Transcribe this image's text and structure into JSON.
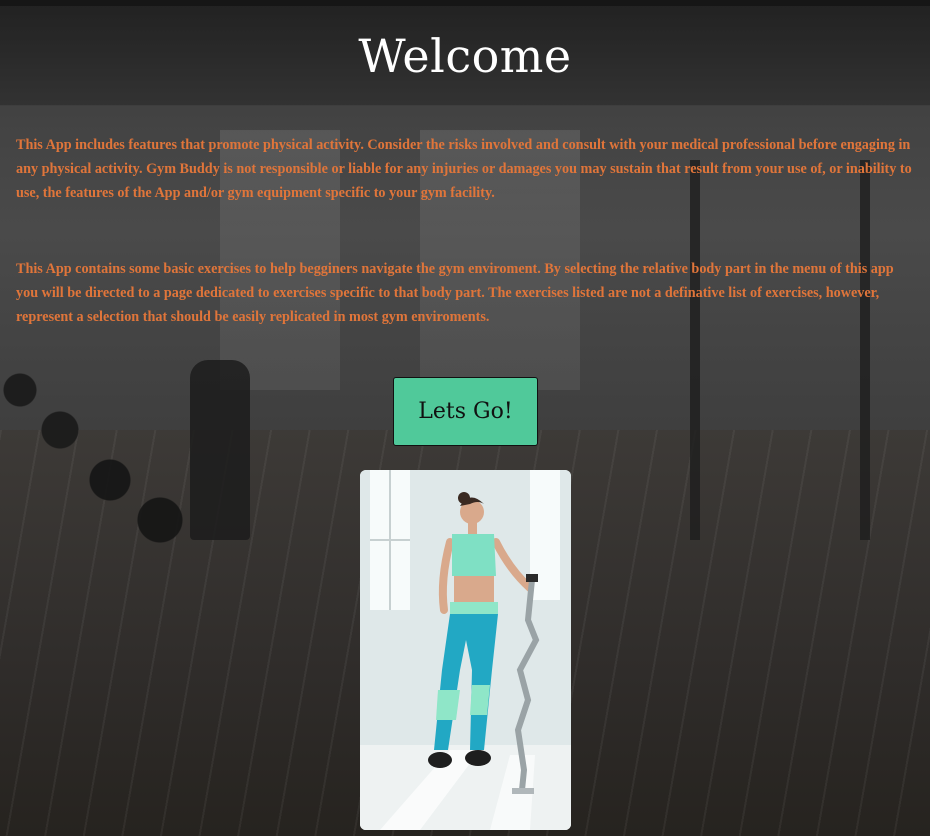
{
  "header": {
    "title": "Welcome"
  },
  "main": {
    "disclaimer": "This App includes features that promote physical activity. Consider the risks involved and consult with your medical professional before engaging in any physical activity. Gym Buddy is not responsible or liable for any injuries or damages you may sustain that result from your use of, or inability to use, the features of the App and/or gym equipment specific to your gym facility.",
    "intro": "This App contains some basic exercises to help begginers navigate the gym enviroment. By selecting the relative body part in the menu of this app you will be directed to a page dedicated to exercises specific to that body part. The exercises listed are not a definative list of exercises, however, represent a selection that should be easily replicated in most gym enviroments.",
    "cta_label": "Lets Go!"
  },
  "colors": {
    "text_accent": "#e0753a",
    "button": "#50c99a",
    "title": "#ffffff"
  },
  "images": {
    "background": "gym-interior-photo",
    "hero": "woman-with-barbell-photo"
  }
}
